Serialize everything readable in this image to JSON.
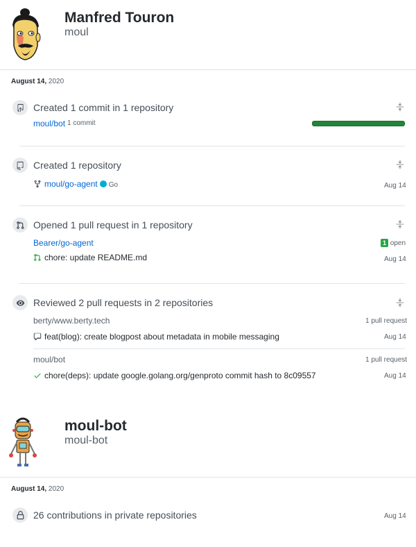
{
  "users": [
    {
      "name": "Manfred Touron",
      "login": "moul",
      "date": "August 14,",
      "year": "2020"
    },
    {
      "name": "moul-bot",
      "login": "moul-bot",
      "date": "August 14,",
      "year": "2020"
    }
  ],
  "events": {
    "commits": {
      "title": "Created 1 commit in 1 repository",
      "repo": "moul/bot",
      "count": "1 commit",
      "progress": 1.0,
      "icon": "repo-push-icon"
    },
    "repo": {
      "title": "Created 1 repository",
      "repo": "moul/go-agent",
      "language": "Go",
      "language_color": "#00ADD8",
      "date": "Aug 14",
      "icon": "repo-icon"
    },
    "pr": {
      "title": "Opened 1 pull request in 1 repository",
      "repo": "Bearer/go-agent",
      "open_count": "1",
      "open_label": "open",
      "pr_title": "chore: update README.md",
      "date": "Aug 14",
      "icon": "git-pull-request-icon"
    },
    "reviews": {
      "title": "Reviewed 2 pull requests in 2 repositories",
      "groups": [
        {
          "repo": "berty/www.berty.tech",
          "count": "1 pull request",
          "item": "feat(blog): create blogpost about metadata in mobile messaging",
          "date": "Aug 14"
        },
        {
          "repo": "moul/bot",
          "count": "1 pull request",
          "item": "chore(deps): update google.golang.org/genproto commit hash to 8c09557",
          "date": "Aug 14"
        }
      ],
      "icon": "eye-icon"
    },
    "private": {
      "title": "26 contributions in private repositories",
      "date": "Aug 14",
      "icon": "lock-icon"
    }
  },
  "colors": {
    "link": "#0366d6",
    "success": "#28a745",
    "bar": "#22863a"
  }
}
